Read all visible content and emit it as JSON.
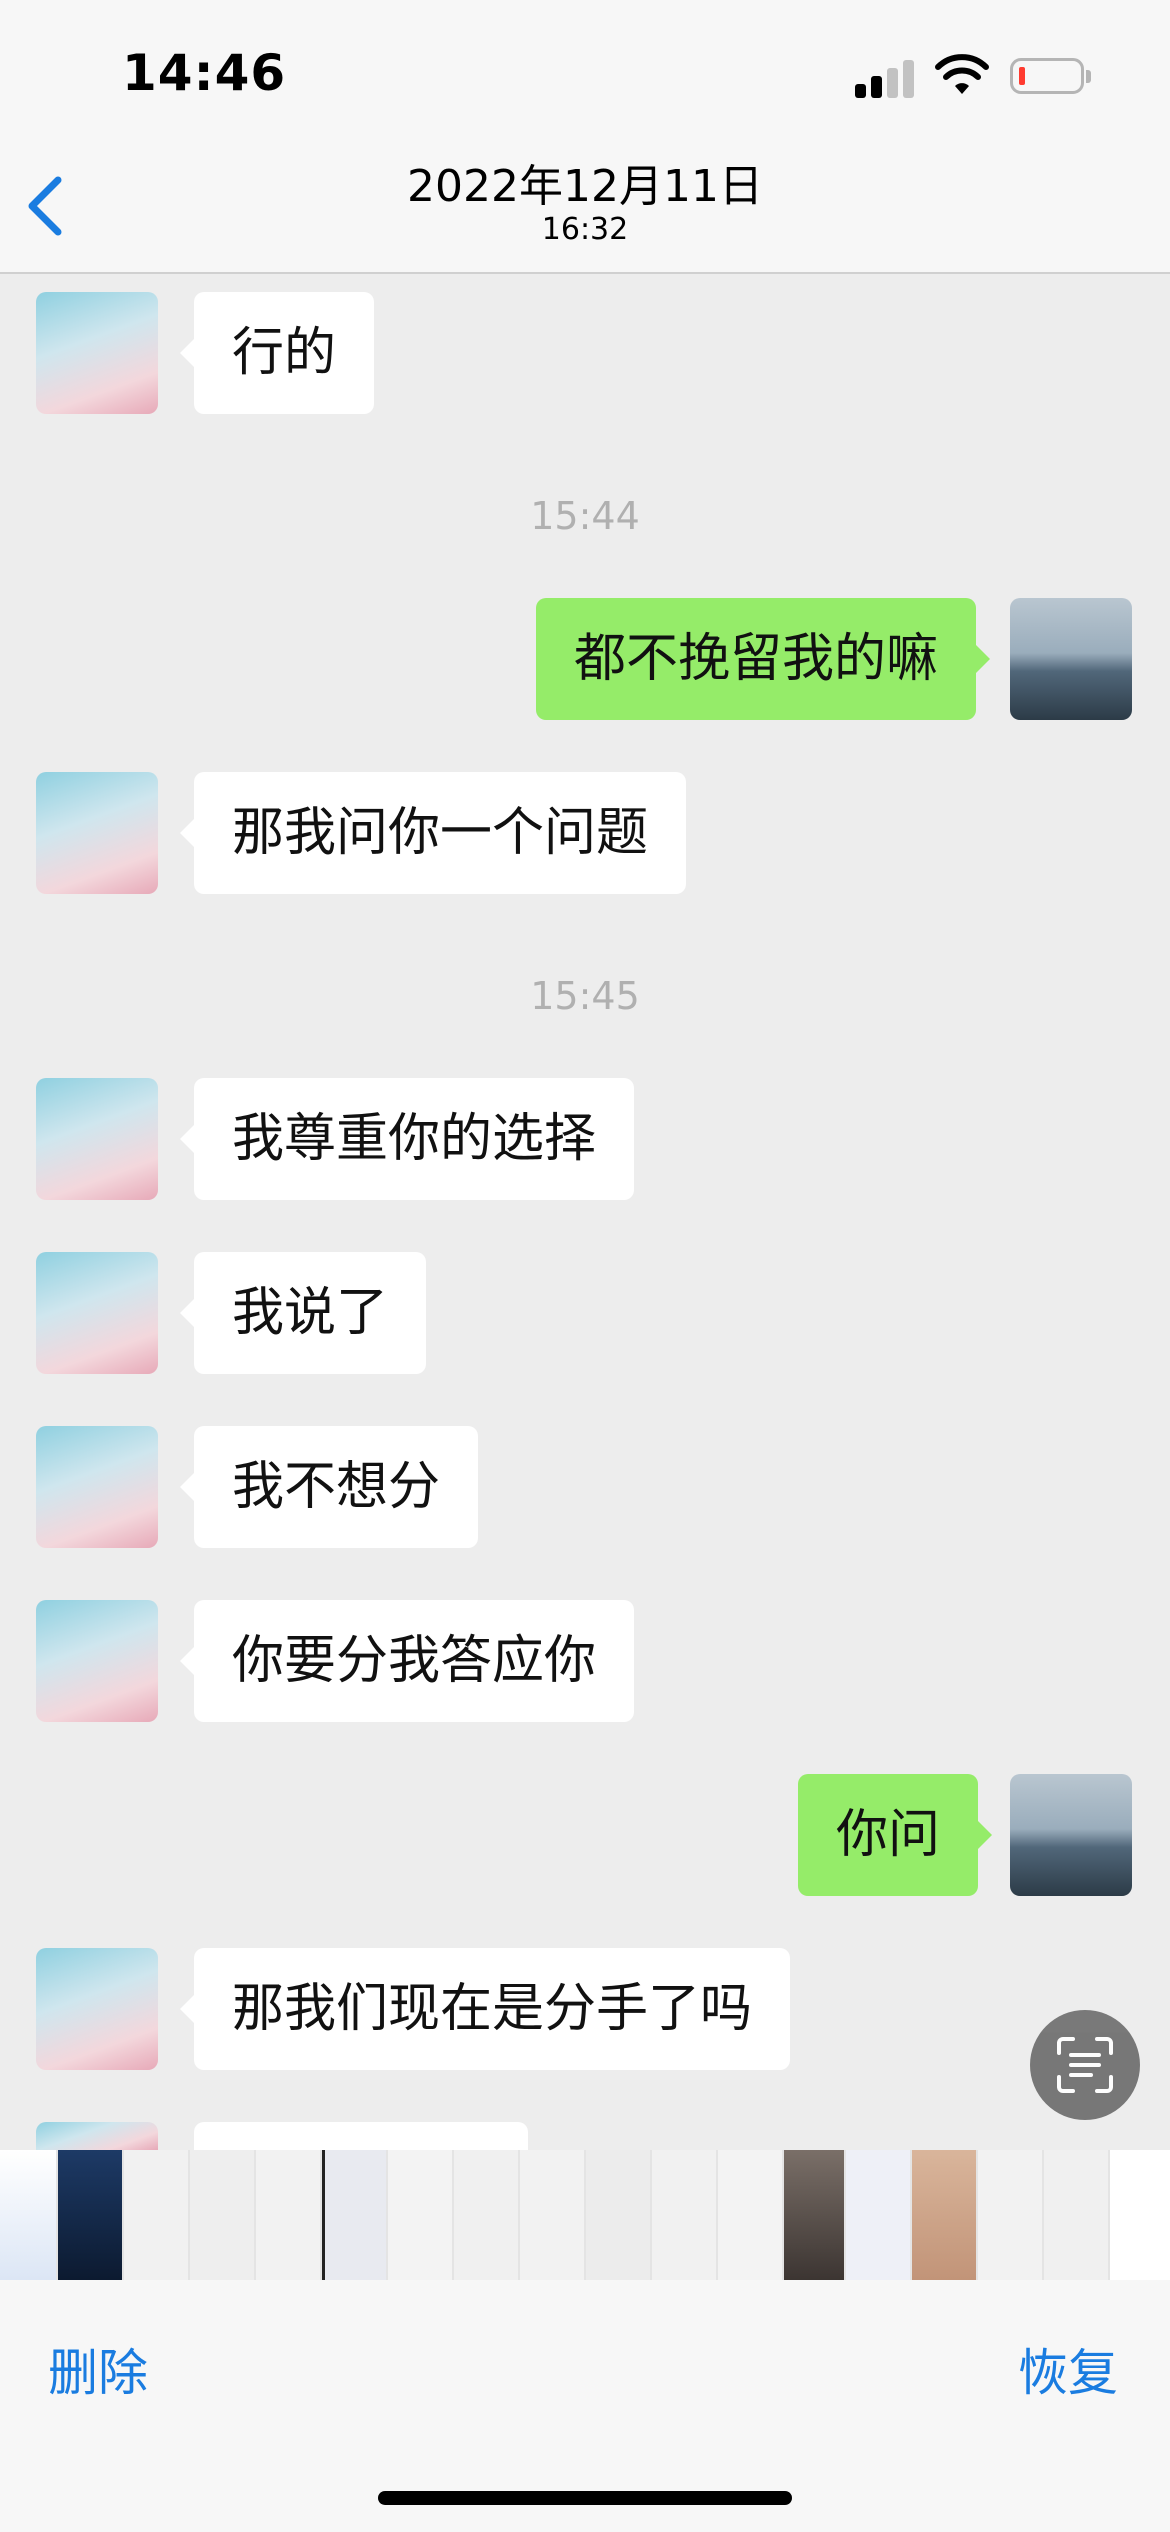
{
  "status_bar": {
    "time": "14:46",
    "signal_icon": "cellular-signal-icon",
    "wifi_icon": "wifi-icon",
    "battery_icon": "battery-low-icon",
    "battery_level_fraction": 0.1
  },
  "nav": {
    "back_icon": "chevron-left-icon",
    "date": "2022年12月11日",
    "time": "16:32"
  },
  "messages": [
    {
      "side": "in",
      "text": "行的"
    },
    {
      "timestamp": "15:44"
    },
    {
      "side": "out",
      "text": "都不挽留我的嘛"
    },
    {
      "side": "in",
      "text": "那我问你一个问题"
    },
    {
      "timestamp": "15:45"
    },
    {
      "side": "in",
      "text": "我尊重你的选择"
    },
    {
      "side": "in",
      "text": "我说了"
    },
    {
      "side": "in",
      "text": "我不想分"
    },
    {
      "side": "in",
      "text": "你要分我答应你"
    },
    {
      "side": "out",
      "text": "你问"
    },
    {
      "side": "in",
      "text": "那我们现在是分手了吗"
    }
  ],
  "scan_button_icon": "text-scan-icon",
  "bottom_bar": {
    "delete_label": "删除",
    "restore_label": "恢复"
  },
  "colors": {
    "chat_background": "#ededed",
    "incoming_bubble": "#ffffff",
    "outgoing_bubble": "#95ec69",
    "action_blue": "#1a7ce0",
    "battery_red": "#ff3b30"
  }
}
